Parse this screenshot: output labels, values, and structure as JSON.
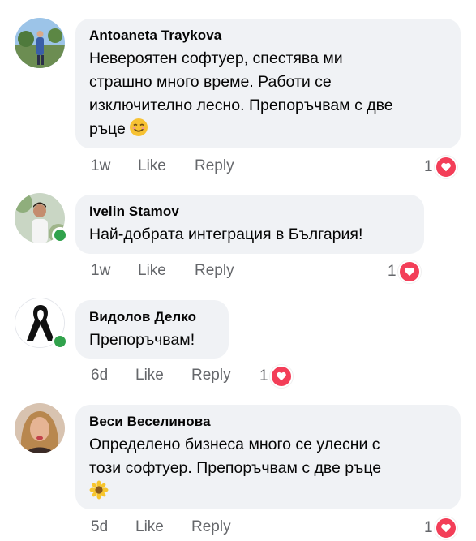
{
  "comments": [
    {
      "author": "Antoaneta Traykova",
      "text_lines": [
        "Невероятен софтуер, спестява ми",
        "страшно много време. Работи се",
        "изключително лесно. Препоръчвам с две",
        "ръце"
      ],
      "emoji": "smiling-face-icon",
      "online": false,
      "time": "1w",
      "like_label": "Like",
      "reply_label": "Reply",
      "reaction_count": "1",
      "reaction": "heart-icon"
    },
    {
      "author": "Ivelin Stamov",
      "text_lines": [
        "Най-добрата интеграция в България!"
      ],
      "emoji": "",
      "online": true,
      "time": "1w",
      "like_label": "Like",
      "reply_label": "Reply",
      "reaction_count": "1",
      "reaction": "heart-icon"
    },
    {
      "author": "Видолов Делко",
      "text_lines": [
        "Препоръчвам!"
      ],
      "emoji": "",
      "online": true,
      "time": "6d",
      "like_label": "Like",
      "reply_label": "Reply",
      "reaction_count": "1",
      "reaction": "heart-icon"
    },
    {
      "author": "Веси Веселинова",
      "text_lines": [
        "Определено бизнеса много се улесни с",
        "този софтуер. Препоръчвам с две ръце"
      ],
      "emoji": "sunflower-icon",
      "online": false,
      "time": "5d",
      "like_label": "Like",
      "reply_label": "Reply",
      "reaction_count": "1",
      "reaction": "heart-icon"
    }
  ],
  "colors": {
    "bubble": "#f0f2f5",
    "meta_text": "#65676b",
    "heart": "#f33e58",
    "online": "#31a24c"
  }
}
